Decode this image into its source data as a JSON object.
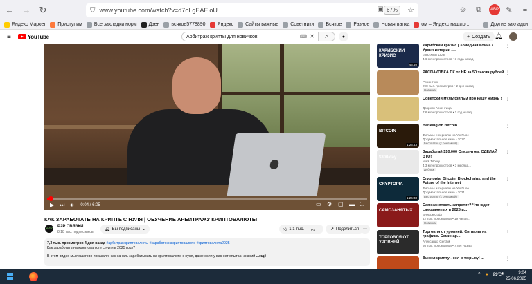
{
  "browser": {
    "url": "www.youtube.com/watch?v=d7oLgEAEloU",
    "zoom": "67%",
    "bookmarks": [
      {
        "label": "Яндекс Маркет",
        "color": "#ffcc00"
      },
      {
        "label": "Приступим",
        "color": "#fd7a3c"
      },
      {
        "label": "Все закладки норм",
        "color": "#9aa0a6"
      },
      {
        "label": "Дзен",
        "color": "#222222"
      },
      {
        "label": "всякое5778890",
        "color": "#9aa0a6"
      },
      {
        "label": "Яндекс",
        "color": "#e53935"
      },
      {
        "label": "Сайты важные",
        "color": "#9aa0a6"
      },
      {
        "label": "Советники",
        "color": "#9aa0a6"
      },
      {
        "label": "Всякое",
        "color": "#9aa0a6"
      },
      {
        "label": "Разное",
        "color": "#9aa0a6"
      },
      {
        "label": "Новая папка",
        "color": "#9aa0a6"
      },
      {
        "label": "ом – Яндекс нашло...",
        "color": "#e53935"
      },
      {
        "label": "Другие закладки",
        "color": "#9aa0a6"
      }
    ]
  },
  "youtube": {
    "logo": "YouTube",
    "search_query": "Арбитраж крипты для новичков",
    "create_label": "Создать"
  },
  "player": {
    "time": "0:04 / 6:05",
    "progress_fraction": 0.01
  },
  "video": {
    "title": "КАК ЗАРАБОТАТЬ НА КРИПТЕ С НУЛЯ | ОБУЧЕНИЕ АРБИТРАЖУ КРИПТОВАЛЮТЫ",
    "channel": "P2P СВЯЗКИ",
    "channel_avatar_text": "P2P",
    "subscribers": "8,18 тыс. подписчиков",
    "subscribe_label": "Вы подписаны",
    "likes": "1,1 тыс.",
    "share_label": "Поделиться",
    "views_date": "7,3 тыс. просмотров  4 дня назад",
    "tags": "#арбитражкриптовалюты #заработокнакриптовалюте #криптовалюта2025",
    "desc_line1": "Как заработать на криптовалюте с нуля в 2025 году?",
    "desc_line2": "В этом видео мы пошагово показали, как начать зарабатывать на криптовалюте с нуля, даже если у вас нет опыта и знаний",
    "desc_more": "...ещё"
  },
  "recommendations": [
    {
      "title": "Карибский кризис | Холодная война / Уроки истории /...",
      "channel": "MIRANCE LIVE",
      "meta": "4,6 млн просмотров • 3 года назад",
      "duration": "45:40",
      "badge": "",
      "thumb_text": "КАРИБСКИЙ КРИЗИС",
      "thumb_color": "#1b2a4a"
    },
    {
      "title": "РАСПАКОВКА ПК от HP за 50 тысяч рублей",
      "channel": "Ремонтник",
      "meta": "298 тыс. просмотров • 2 дня назад",
      "duration": "",
      "badge": "Новинка",
      "thumb_text": "",
      "thumb_color": "#b88a5a"
    },
    {
      "title": "Советский мультфильм про нашу жизнь !",
      "channel": "Дворкин Аркентица",
      "meta": "7,6 млн просмотров • 1 год назад",
      "duration": "",
      "badge": "",
      "thumb_text": "",
      "thumb_color": "#d9c07a"
    },
    {
      "title": "Banking on Bitcoin",
      "channel": "Фильмы и сериалы на YouTube",
      "meta": "Документальное кино • 2017",
      "duration": "1:23:43",
      "badge": "Бесплатно (с рекламой)",
      "thumb_text": "BITCOIN",
      "thumb_color": "#2a1a0a"
    },
    {
      "title": "Заработай $10,000 Студентом: СДЕЛАЙ ЭТО!",
      "channel": "Mark Tilbury",
      "meta": "4,3 млн просмотров • 3 месяца...",
      "duration": "",
      "badge": "Дубляж",
      "thumb_text": "$300/day",
      "thumb_color": "#e9e9e9"
    },
    {
      "title": "Cryptopia: Bitcoin, Blockchains, and the Future of the Internet",
      "channel": "Фильмы и сериалы на YouTube",
      "meta": "Документальное кино • 2021",
      "duration": "1:26:33",
      "badge": "Бесплатно (с рекламой)",
      "thumb_text": "CRYPTOPIA",
      "thumb_color": "#0d2a3a"
    },
    {
      "title": "Самозанятость запретят? Что ждет самозанятых в 2025 и...",
      "channel": "ВнешЭкСофт",
      "meta": "42 тыс. просмотров • 19 часов...",
      "duration": "",
      "badge": "Новинка",
      "thumb_text": "САМОЗАНЯТЫХ",
      "thumb_color": "#8a1a1a"
    },
    {
      "title": "Торговля от уровней. Сигналы на графике. Семинар...",
      "channel": "Александр Gerchik",
      "meta": "56 тыс. просмотров • 7 лет назад",
      "duration": "",
      "badge": "",
      "thumb_text": "ТОРГОВЛЯ ОТ УРОВНЕЙ",
      "thumb_color": "#2b2b2b"
    },
    {
      "title": "Вывел крипту - сел в тюрьму! ...",
      "channel": "",
      "meta": "",
      "duration": "",
      "badge": "",
      "thumb_text": "",
      "thumb_color": "#c04a1a"
    }
  ],
  "taskbar": {
    "lang": "РУС",
    "time": "9:04",
    "date": "25.06.2025"
  }
}
